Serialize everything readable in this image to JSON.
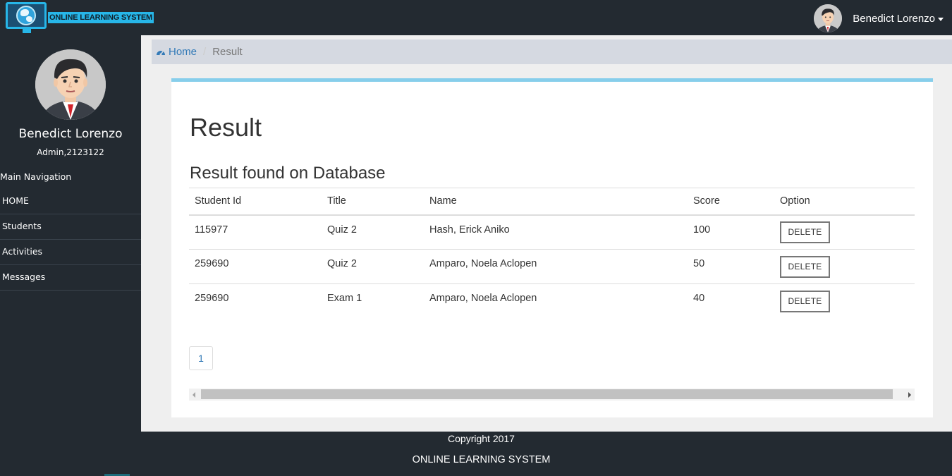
{
  "brand": {
    "logo_text": "ONLINE LEARNING SYSTEM",
    "accent_color": "#27b6e8"
  },
  "user_menu": {
    "name": "Benedict Lorenzo",
    "avatar_icon": "user-avatar"
  },
  "sidebar": {
    "profile_name": "Benedict Lorenzo",
    "profile_role": "Admin,2123122",
    "nav_title": "Main Navigation",
    "items": [
      {
        "label": "HOME"
      },
      {
        "label": "Students"
      },
      {
        "label": "Activities"
      },
      {
        "label": "Messages"
      }
    ]
  },
  "breadcrumb": {
    "home_icon": "dashboard-icon",
    "home_label": "Home",
    "current": "Result"
  },
  "main": {
    "title": "Result",
    "subtitle": "Result found on Database",
    "table": {
      "columns": [
        "Student Id",
        "Title",
        "Name",
        "Score",
        "Option"
      ],
      "rows": [
        {
          "student_id": "115977",
          "title": "Quiz 2",
          "name": "Hash, Erick Aniko",
          "score": "100",
          "option": "DELETE"
        },
        {
          "student_id": "259690",
          "title": "Quiz 2",
          "name": "Amparo, Noela Aclopen",
          "score": "50",
          "option": "DELETE"
        },
        {
          "student_id": "259690",
          "title": "Exam 1",
          "name": "Amparo, Noela Aclopen",
          "score": "40",
          "option": "DELETE"
        }
      ]
    },
    "pagination": {
      "current_page": "1"
    },
    "panel_accent": "#87ceeb"
  },
  "footer": {
    "copyright": "Copyright 2017",
    "title": "ONLINE LEARNING SYSTEM"
  },
  "colors": {
    "dark_bg": "#232a31",
    "link": "#337ab7",
    "breadcrumb_bg": "#d5d9e1"
  }
}
